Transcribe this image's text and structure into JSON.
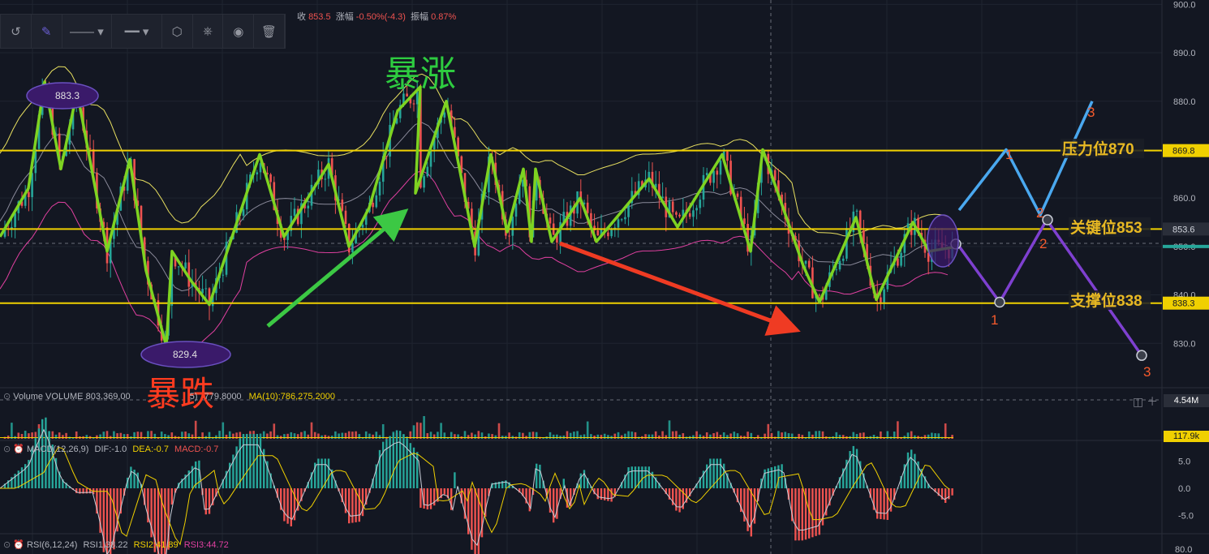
{
  "header": {
    "close_label": "收",
    "close_value": "853.5",
    "change_label": "涨幅",
    "change_value": "-0.50%(-4.3)",
    "amplitude_label": "振幅",
    "amplitude_value": "0.87%"
  },
  "annotations": {
    "surge": "暴涨",
    "crash": "暴跌",
    "high_value": "883.3",
    "low_value": "829.4",
    "resistance": "压力位870",
    "key_level": "关键位853",
    "support": "支撑位838",
    "wave_labels": [
      "1",
      "2",
      "3"
    ]
  },
  "volume_panel": {
    "label": "Volume",
    "name": "VOLUME",
    "value": "803,369,00",
    "ma_frag": "5)",
    "ma5_frag": "779.8000",
    "ma10": "MA(10):786,275.2000",
    "badge_volume": "4.54M",
    "badge_ma": "117.9k"
  },
  "macd_panel": {
    "label": "MACD(12,26,9)",
    "dif": "DIF:-1.0",
    "dea": "DEA:-0.7",
    "macd": "MACD:-0.7"
  },
  "rsi_panel": {
    "label": "RSI(6,12,24)",
    "rsi1": "RSI1:38.22",
    "rsi2": "RSI2:41.89",
    "rsi3": "RSI3:44.72"
  },
  "colors": {
    "background": "#131722",
    "up": "#26a69a",
    "down": "#ef5350",
    "level_line": "#f0d000",
    "zigzag": "#7ed321",
    "surge_text": "#2ecc40",
    "crash_text": "#ff3b1f",
    "arrow_green": "#3cc844",
    "arrow_red": "#ef3b23",
    "bull_path": "#4aa8ef",
    "bear_path": "#7e40d0",
    "level_text": "#e8b923",
    "boll_upper": "#e8e060",
    "boll_lower": "#e040a0",
    "boll_mid": "#8a8a9a",
    "wave_number": "#f55a2c"
  },
  "chart_data": {
    "type": "candlestick",
    "y_axis": {
      "ticks": [
        900.0,
        890.0,
        880.0,
        870.0,
        860.0,
        850.0,
        840.0,
        830.0
      ],
      "range": [
        825,
        900
      ]
    },
    "price_badges": [
      {
        "value": 869.8,
        "label": "869.8",
        "color": "#f0d000",
        "text_color": "#131722"
      },
      {
        "value": 853.6,
        "label": "853.6",
        "color": "#2a2e39",
        "text_color": "#d1d4dc"
      },
      {
        "value": 838.3,
        "label": "838.3",
        "color": "#f0d000",
        "text_color": "#131722"
      }
    ],
    "horizontal_levels": [
      {
        "name": "resistance",
        "value": 869.8
      },
      {
        "name": "key",
        "value": 853.6
      },
      {
        "name": "support",
        "value": 838.3
      }
    ],
    "zigzag": [
      [
        0,
        852
      ],
      [
        35,
        862
      ],
      [
        55,
        884
      ],
      [
        75,
        866
      ],
      [
        95,
        882
      ],
      [
        132,
        849
      ],
      [
        160,
        868
      ],
      [
        180,
        845
      ],
      [
        205,
        829.4
      ],
      [
        212,
        849
      ],
      [
        235,
        843
      ],
      [
        258,
        838
      ],
      [
        320,
        869
      ],
      [
        350,
        852
      ],
      [
        405,
        867
      ],
      [
        430,
        850
      ],
      [
        455,
        858
      ],
      [
        490,
        878
      ],
      [
        518,
        883
      ],
      [
        512,
        861
      ],
      [
        550,
        880
      ],
      [
        585,
        850
      ],
      [
        605,
        869
      ],
      [
        625,
        853
      ],
      [
        645,
        866
      ],
      [
        655,
        851
      ],
      [
        660,
        866
      ],
      [
        680,
        851
      ],
      [
        715,
        860
      ],
      [
        735,
        851
      ],
      [
        800,
        864
      ],
      [
        835,
        854
      ],
      [
        890,
        869
      ],
      [
        925,
        849
      ],
      [
        940,
        870
      ],
      [
        990,
        846
      ],
      [
        1010,
        838.5
      ],
      [
        1055,
        856
      ],
      [
        1080,
        839
      ],
      [
        1125,
        855
      ],
      [
        1145,
        849
      ],
      [
        1180,
        850
      ]
    ],
    "bull_projection": [
      [
        1182,
        857.5
      ],
      [
        1240,
        870
      ],
      [
        1282,
        856.5
      ],
      [
        1346,
        880
      ]
    ],
    "bear_projection": [
      [
        1180,
        850.5
      ],
      [
        1232,
        838.5
      ],
      [
        1290,
        855.5
      ],
      [
        1407,
        827.5
      ]
    ],
    "volume_axis": {
      "ticks": []
    },
    "macd_axis": {
      "ticks": [
        5.0,
        0.0,
        -5.0
      ]
    },
    "rsi_axis": {
      "ticks": [
        80.0
      ]
    }
  }
}
